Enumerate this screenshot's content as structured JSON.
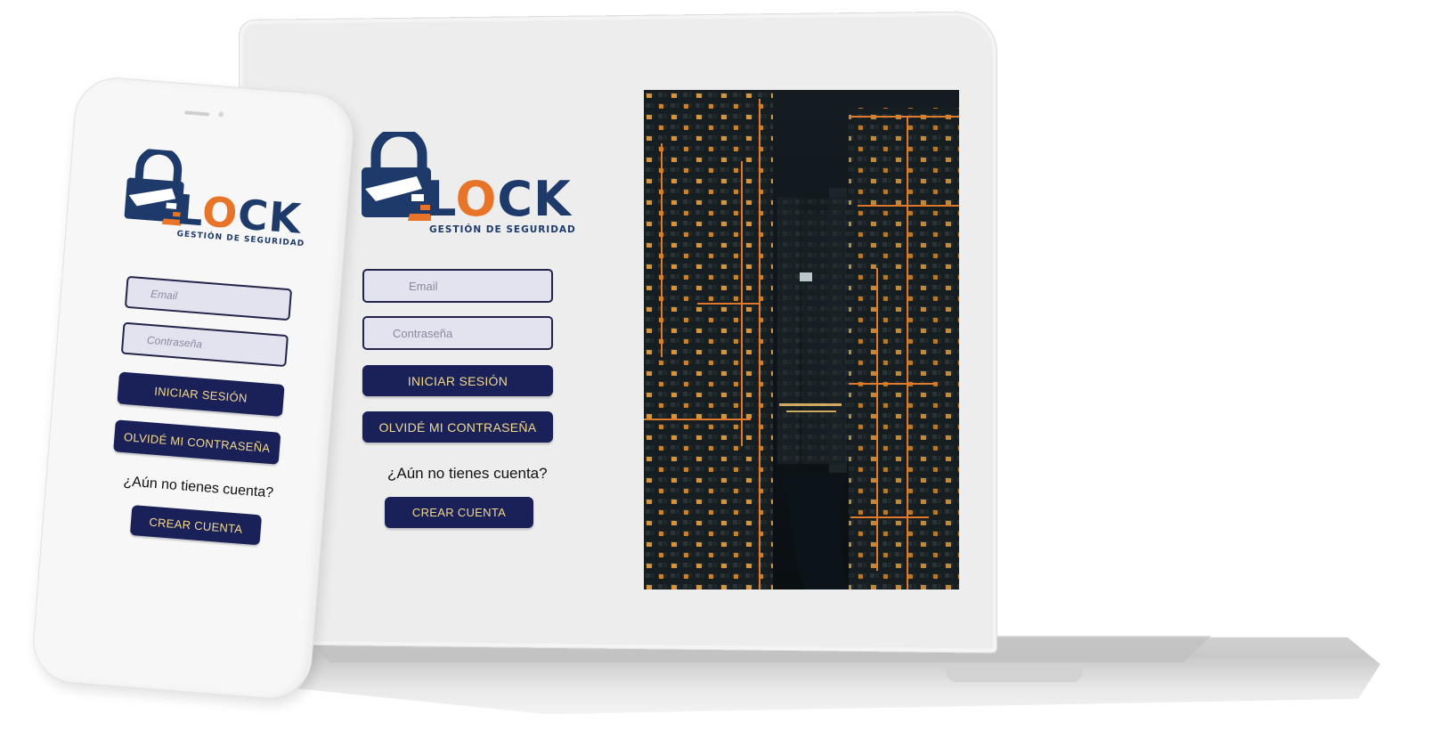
{
  "brand": {
    "name_pre": "L",
    "name_o": "O",
    "name_post": "CK",
    "tagline": "GESTIÓN DE SEGURIDAD",
    "colors": {
      "navy": "#1e3a6a",
      "orange": "#e8742a",
      "button": "#1a2159",
      "button_text": "#f3d98c"
    }
  },
  "login": {
    "email_placeholder": "Email",
    "password_placeholder": "Contraseña",
    "login_button": "INICIAR SESIÓN",
    "forgot_button": "OLVIDÉ MI CONTRASEÑA",
    "no_account": "¿Aún no tienes cuenta?",
    "create_button": "CREAR CUENTA"
  },
  "icons": [
    "padlock-logo-icon",
    "keyhole-icon",
    "security-camera-icon"
  ],
  "hero_image": "night-city-skyscrapers-photo"
}
